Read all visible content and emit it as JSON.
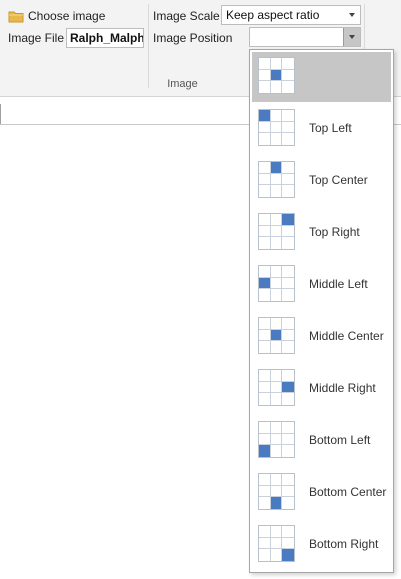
{
  "ribbon": {
    "choose_image_label": "Choose image",
    "image_file_label": "Image File",
    "image_file_value": "Ralph_Malph.",
    "image_scale_label": "Image Scale",
    "image_scale_value": "Keep aspect ratio",
    "image_position_label": "Image Position",
    "image_position_value": "",
    "group_label": "Image"
  },
  "dropdown": {
    "selected_index": 0,
    "options": [
      {
        "label": "",
        "cell": 4
      },
      {
        "label": "Top Left",
        "cell": 0
      },
      {
        "label": "Top Center",
        "cell": 1
      },
      {
        "label": "Top Right",
        "cell": 2
      },
      {
        "label": "Middle Left",
        "cell": 3
      },
      {
        "label": "Middle Center",
        "cell": 4
      },
      {
        "label": "Middle Right",
        "cell": 5
      },
      {
        "label": "Bottom Left",
        "cell": 6
      },
      {
        "label": "Bottom Center",
        "cell": 7
      },
      {
        "label": "Bottom Right",
        "cell": 8
      }
    ]
  },
  "colors": {
    "highlight_cell": "#4a7bc0",
    "selected_row": "#c6c6c6",
    "folder": "#e8b94a"
  },
  "icons": {
    "choose_image": "folder-icon",
    "combo_arrow": "chevron-down-icon"
  }
}
